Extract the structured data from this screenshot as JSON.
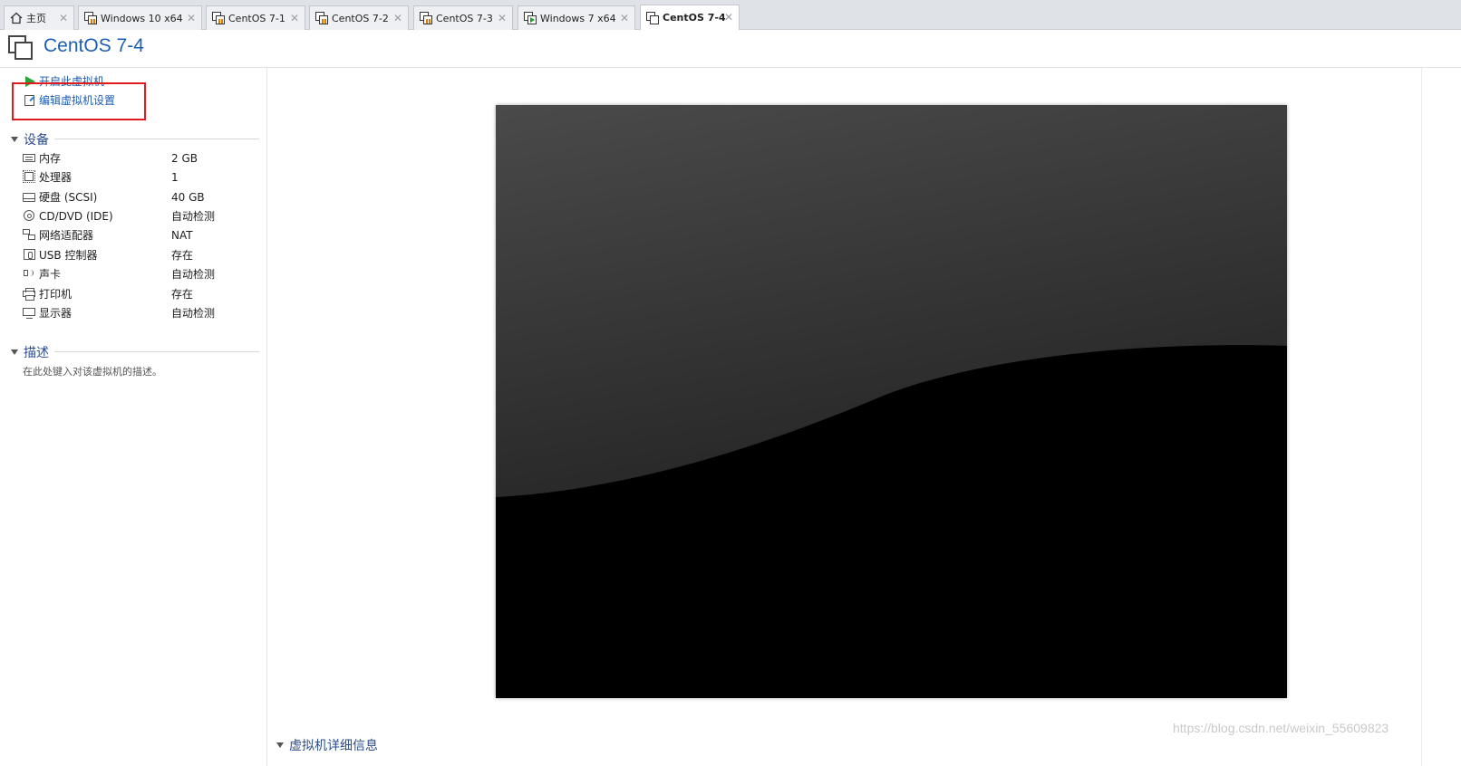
{
  "tabs": [
    {
      "label": "主页",
      "icon": "home-icon",
      "active": false
    },
    {
      "label": "Windows 10 x64",
      "icon": "vm-suspended-icon",
      "active": false
    },
    {
      "label": "CentOS 7-1",
      "icon": "vm-suspended-icon",
      "active": false
    },
    {
      "label": "CentOS 7-2",
      "icon": "vm-suspended-icon",
      "active": false
    },
    {
      "label": "CentOS 7-3",
      "icon": "vm-suspended-icon",
      "active": false
    },
    {
      "label": "Windows 7 x64",
      "icon": "vm-running-icon",
      "active": false
    },
    {
      "label": "CentOS 7-4",
      "icon": "vm-icon",
      "active": true
    }
  ],
  "header": {
    "title": "CentOS 7-4"
  },
  "actions": {
    "power_on": "开启此虚拟机",
    "edit_settings": "编辑虚拟机设置"
  },
  "devices": {
    "heading": "设备",
    "items": [
      {
        "name": "内存",
        "value": "2 GB",
        "icon": "memory-icon"
      },
      {
        "name": "处理器",
        "value": "1",
        "icon": "cpu-icon"
      },
      {
        "name": "硬盘 (SCSI)",
        "value": "40 GB",
        "icon": "hard-disk-icon"
      },
      {
        "name": "CD/DVD (IDE)",
        "value": "自动检测",
        "icon": "cd-dvd-icon"
      },
      {
        "name": "网络适配器",
        "value": "NAT",
        "icon": "network-adapter-icon"
      },
      {
        "name": "USB 控制器",
        "value": "存在",
        "icon": "usb-controller-icon"
      },
      {
        "name": "声卡",
        "value": "自动检测",
        "icon": "sound-card-icon"
      },
      {
        "name": "打印机",
        "value": "存在",
        "icon": "printer-icon"
      },
      {
        "name": "显示器",
        "value": "自动检测",
        "icon": "display-icon"
      }
    ]
  },
  "description": {
    "heading": "描述",
    "placeholder": "在此处键入对该虚拟机的描述。"
  },
  "details": {
    "heading": "虚拟机详细信息"
  },
  "watermark": "https://blog.csdn.net/weixin_55609823",
  "colors": {
    "accent": "#1c5fb5",
    "highlight": "#e01b1b",
    "play": "#2aa33a"
  }
}
